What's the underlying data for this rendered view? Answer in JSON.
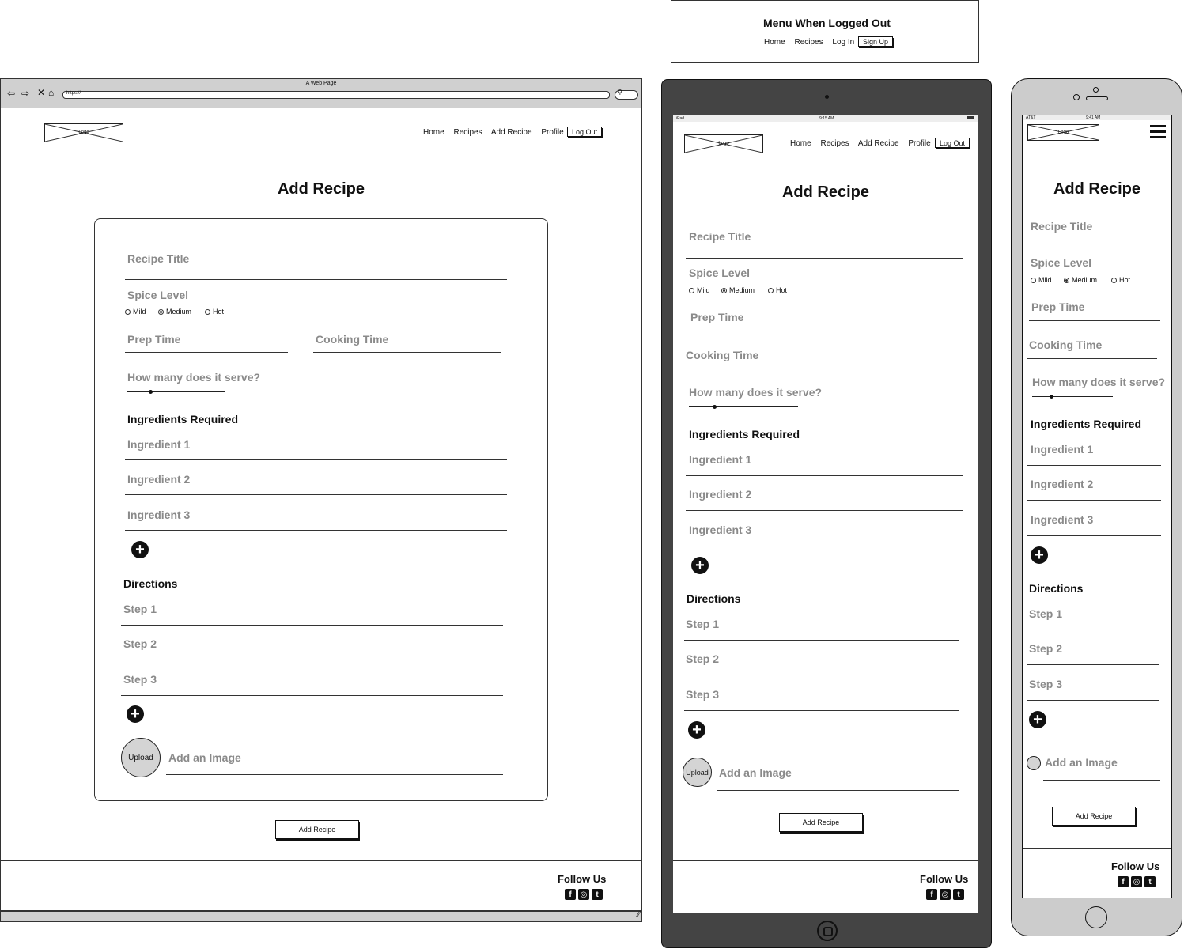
{
  "logged_out_menu": {
    "title": "Menu When Logged Out",
    "items": [
      "Home",
      "Recipes",
      "Log In"
    ],
    "signup": "Sign Up"
  },
  "browser": {
    "tab_title": "A Web Page",
    "url": "https://"
  },
  "nav": {
    "items": [
      "Home",
      "Recipes",
      "Add Recipe",
      "Profile"
    ],
    "logout": "Log Out"
  },
  "logo": "Logo",
  "page": {
    "title": "Add Recipe",
    "recipe_title": "Recipe Title",
    "spice_level": "Spice Level",
    "spice_options": [
      "Mild",
      "Medium",
      "Hot"
    ],
    "spice_selected": "Medium",
    "prep_time": "Prep Time",
    "cooking_time": "Cooking Time",
    "serves": "How many does it serve?",
    "ingredients_heading": "Ingredients Required",
    "ingredients": [
      "Ingredient 1",
      "Ingredient 2",
      "Ingredient 3"
    ],
    "directions_heading": "Directions",
    "steps": [
      "Step 1",
      "Step 2",
      "Step 3"
    ],
    "upload": "Upload",
    "add_image": "Add an Image",
    "submit": "Add Recipe"
  },
  "footer": {
    "follow": "Follow Us",
    "social_icons": [
      "facebook-icon",
      "instagram-icon",
      "twitter-icon"
    ]
  },
  "tablet_status": {
    "device": "iPad",
    "time": "9:15 AM"
  },
  "phone_status": {
    "carrier": "AT&T",
    "time": "9:41 AM"
  }
}
